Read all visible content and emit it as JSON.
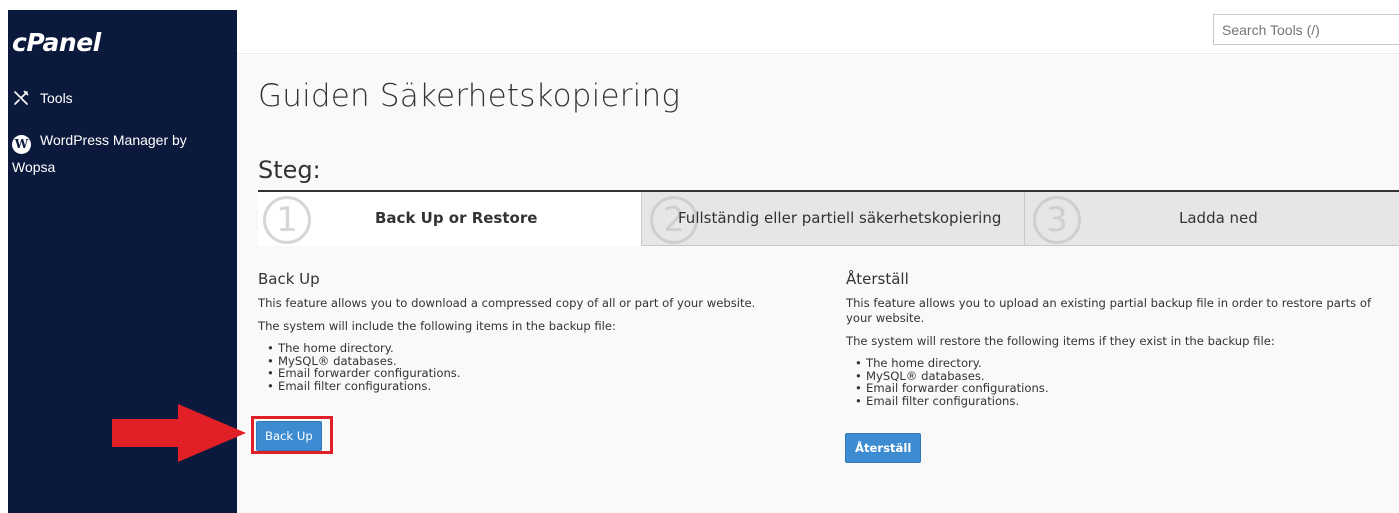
{
  "sidebar": {
    "logo": "cPanel",
    "items": [
      {
        "label": "Tools",
        "icon": "tools-icon"
      },
      {
        "label": "WordPress Manager by Wopsa",
        "icon": "wordpress-icon"
      }
    ]
  },
  "topbar": {
    "search_placeholder": "Search Tools (/)"
  },
  "page": {
    "title": "Guiden Säkerhetskopiering",
    "steps_heading": "Steg:",
    "steps": [
      {
        "number": "1",
        "label": "Back Up or Restore",
        "active": true
      },
      {
        "number": "2",
        "label": "Fullständig eller partiell säkerhetskopiering",
        "active": false
      },
      {
        "number": "3",
        "label": "Ladda ned",
        "active": false
      }
    ]
  },
  "backup": {
    "heading": "Back Up",
    "description": "This feature allows you to download a compressed copy of all or part of your website.",
    "intro": "The system will include the following items in the backup file:",
    "items": [
      "The home directory.",
      "MySQL® databases.",
      "Email forwarder configurations.",
      "Email filter configurations."
    ],
    "button": "Back Up"
  },
  "restore": {
    "heading": "Återställ",
    "description": "This feature allows you to upload an existing partial backup file in order to restore parts of your website.",
    "intro": "The system will restore the following items if they exist in the backup file:",
    "items": [
      "The home directory.",
      "MySQL® databases.",
      "Email forwarder configurations.",
      "Email filter configurations."
    ],
    "button": "Återställ"
  },
  "colors": {
    "sidebar_bg": "#0b1a3c",
    "button_blue": "#3d8bd1",
    "annotation_red": "#e01f26"
  }
}
